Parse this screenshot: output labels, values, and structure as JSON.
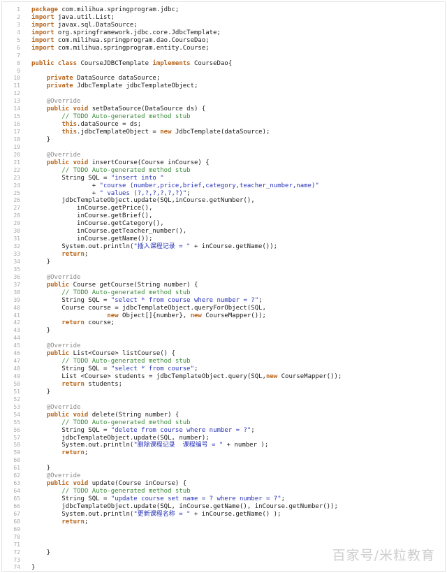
{
  "colors": {
    "keyword": "#b7651b",
    "string": "#2934b8",
    "comment": "#3b8a3b",
    "annotation": "#8a8a8a",
    "text": "#1a1a1a",
    "line_number": "#a8a8a8"
  },
  "watermark": "百家号/米粒教育",
  "lines": [
    [
      [
        "kw",
        "package"
      ],
      [
        "p",
        " com.milihua.springprogram.jdbc;"
      ]
    ],
    [
      [
        "kw",
        "import"
      ],
      [
        "p",
        " java.util.List;"
      ]
    ],
    [
      [
        "kw",
        "import"
      ],
      [
        "p",
        " javax.sql.DataSource;"
      ]
    ],
    [
      [
        "kw",
        "import"
      ],
      [
        "p",
        " org.springframework.jdbc.core.JdbcTemplate;"
      ]
    ],
    [
      [
        "kw",
        "import"
      ],
      [
        "p",
        " com.milihua.springprogram.dao.CourseDao;"
      ]
    ],
    [
      [
        "kw",
        "import"
      ],
      [
        "p",
        " com.milihua.springprogram.entity.Course;"
      ]
    ],
    [],
    [
      [
        "kw",
        "public class"
      ],
      [
        "p",
        " CourseJDBCTemplate "
      ],
      [
        "kw",
        "implements"
      ],
      [
        "p",
        " CourseDao{"
      ]
    ],
    [],
    [
      [
        "p",
        "    "
      ],
      [
        "kw",
        "private"
      ],
      [
        "p",
        " DataSource dataSource;"
      ]
    ],
    [
      [
        "p",
        "    "
      ],
      [
        "kw",
        "private"
      ],
      [
        "p",
        " JdbcTemplate jdbcTemplateObject;"
      ]
    ],
    [],
    [
      [
        "p",
        "    "
      ],
      [
        "ann",
        "@Override"
      ]
    ],
    [
      [
        "p",
        "    "
      ],
      [
        "kw",
        "public void"
      ],
      [
        "p",
        " setDataSource(DataSource ds) {"
      ]
    ],
    [
      [
        "p",
        "        "
      ],
      [
        "com",
        "// TODO Auto-generated method stub"
      ]
    ],
    [
      [
        "p",
        "        "
      ],
      [
        "kw",
        "this"
      ],
      [
        "p",
        ".dataSource = ds;"
      ]
    ],
    [
      [
        "p",
        "        "
      ],
      [
        "kw",
        "this"
      ],
      [
        "p",
        ".jdbcTemplateObject = "
      ],
      [
        "kw",
        "new"
      ],
      [
        "p",
        " JdbcTemplate(dataSource);"
      ]
    ],
    [
      [
        "p",
        "    }"
      ]
    ],
    [],
    [
      [
        "p",
        "    "
      ],
      [
        "ann",
        "@Override"
      ]
    ],
    [
      [
        "p",
        "    "
      ],
      [
        "kw",
        "public void"
      ],
      [
        "p",
        " insertCourse(Course inCourse) {"
      ]
    ],
    [
      [
        "p",
        "        "
      ],
      [
        "com",
        "// TODO Auto-generated method stub"
      ]
    ],
    [
      [
        "p",
        "        String SQL = "
      ],
      [
        "str",
        "\"insert into \""
      ]
    ],
    [
      [
        "p",
        "                + "
      ],
      [
        "str",
        "\"course (number,price,brief,category,teacher_number,name)\""
      ]
    ],
    [
      [
        "p",
        "                + "
      ],
      [
        "str",
        "\" values (?,?,?,?,?,?)\""
      ],
      [
        "p",
        ";"
      ]
    ],
    [
      [
        "p",
        "        jdbcTemplateObject.update(SQL,inCourse.getNumber(),"
      ]
    ],
    [
      [
        "p",
        "            inCourse.getPrice(),"
      ]
    ],
    [
      [
        "p",
        "            inCourse.getBrief(),"
      ]
    ],
    [
      [
        "p",
        "            inCourse.getCategory(),"
      ]
    ],
    [
      [
        "p",
        "            inCourse.getTeacher_number(),"
      ]
    ],
    [
      [
        "p",
        "            inCourse.getName());"
      ]
    ],
    [
      [
        "p",
        "        System.out.println("
      ],
      [
        "str",
        "\"插入课程记录 = \""
      ],
      [
        "p",
        " + inCourse.getName());"
      ]
    ],
    [
      [
        "p",
        "        "
      ],
      [
        "kw",
        "return"
      ],
      [
        "p",
        ";"
      ]
    ],
    [
      [
        "p",
        "    }"
      ]
    ],
    [],
    [
      [
        "p",
        "    "
      ],
      [
        "ann",
        "@Override"
      ]
    ],
    [
      [
        "p",
        "    "
      ],
      [
        "kw",
        "public"
      ],
      [
        "p",
        " Course getCourse(String number) {"
      ]
    ],
    [
      [
        "p",
        "        "
      ],
      [
        "com",
        "// TODO Auto-generated method stub"
      ]
    ],
    [
      [
        "p",
        "        String SQL = "
      ],
      [
        "str",
        "\"select * from course where number = ?\""
      ],
      [
        "p",
        ";"
      ]
    ],
    [
      [
        "p",
        "        Course course = jdbcTemplateObject.queryForObject(SQL,"
      ]
    ],
    [
      [
        "p",
        "                    "
      ],
      [
        "kw",
        "new"
      ],
      [
        "p",
        " Object[]{number}, "
      ],
      [
        "kw",
        "new"
      ],
      [
        "p",
        " CourseMapper());"
      ]
    ],
    [
      [
        "p",
        "        "
      ],
      [
        "kw",
        "return"
      ],
      [
        "p",
        " course;"
      ]
    ],
    [
      [
        "p",
        "    }"
      ]
    ],
    [],
    [
      [
        "p",
        "    "
      ],
      [
        "ann",
        "@Override"
      ]
    ],
    [
      [
        "p",
        "    "
      ],
      [
        "kw",
        "public"
      ],
      [
        "p",
        " List<Course> listCourse() {"
      ]
    ],
    [
      [
        "p",
        "        "
      ],
      [
        "com",
        "// TODO Auto-generated method stub"
      ]
    ],
    [
      [
        "p",
        "        String SQL = "
      ],
      [
        "str",
        "\"select * from course\""
      ],
      [
        "p",
        ";"
      ]
    ],
    [
      [
        "p",
        "        List <Course> students = jdbcTemplateObject.query(SQL,"
      ],
      [
        "kw",
        "new"
      ],
      [
        "p",
        " CourseMapper());"
      ]
    ],
    [
      [
        "p",
        "        "
      ],
      [
        "kw",
        "return"
      ],
      [
        "p",
        " students;"
      ]
    ],
    [
      [
        "p",
        "    }"
      ]
    ],
    [],
    [
      [
        "p",
        "    "
      ],
      [
        "ann",
        "@Override"
      ]
    ],
    [
      [
        "p",
        "    "
      ],
      [
        "kw",
        "public void"
      ],
      [
        "p",
        " delete(String number) {"
      ]
    ],
    [
      [
        "p",
        "        "
      ],
      [
        "com",
        "// TODO Auto-generated method stub"
      ]
    ],
    [
      [
        "p",
        "        String SQL = "
      ],
      [
        "str",
        "\"delete from course where number = ?\""
      ],
      [
        "p",
        ";"
      ]
    ],
    [
      [
        "p",
        "        jdbcTemplateObject.update(SQL, number);"
      ]
    ],
    [
      [
        "p",
        "        System.out.println("
      ],
      [
        "str",
        "\"删除课程记录  课程编号 = \""
      ],
      [
        "p",
        " + number );"
      ]
    ],
    [
      [
        "p",
        "        "
      ],
      [
        "kw",
        "return"
      ],
      [
        "p",
        ";"
      ]
    ],
    [],
    [
      [
        "p",
        "    }"
      ]
    ],
    [
      [
        "p",
        "    "
      ],
      [
        "ann",
        "@Override"
      ]
    ],
    [
      [
        "p",
        "    "
      ],
      [
        "kw",
        "public void"
      ],
      [
        "p",
        " update(Course inCourse) {"
      ]
    ],
    [
      [
        "p",
        "        "
      ],
      [
        "com",
        "// TODO Auto-generated method stub"
      ]
    ],
    [
      [
        "p",
        "        String SQL = "
      ],
      [
        "str",
        "\"update course set name = ? where number = ?\""
      ],
      [
        "p",
        ";"
      ]
    ],
    [
      [
        "p",
        "        jdbcTemplateObject.update(SQL, inCourse.getName(), inCourse.getNumber());"
      ]
    ],
    [
      [
        "p",
        "        System.out.println("
      ],
      [
        "str",
        "\"更新课程名称 = \""
      ],
      [
        "p",
        " + inCourse.getName() );"
      ]
    ],
    [
      [
        "p",
        "        "
      ],
      [
        "kw",
        "return"
      ],
      [
        "p",
        ";"
      ]
    ],
    [],
    [],
    [],
    [
      [
        "p",
        "    }"
      ]
    ],
    [],
    [
      [
        "p",
        "}"
      ]
    ]
  ]
}
